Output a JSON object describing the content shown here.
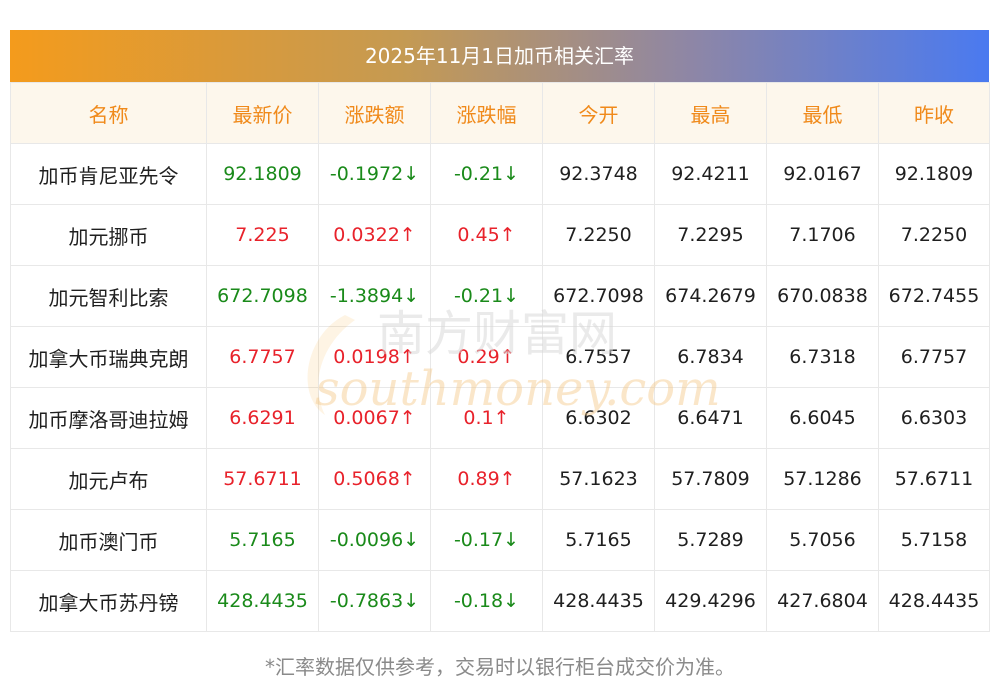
{
  "title": "2025年11月1日加币相关汇率",
  "columns": [
    "名称",
    "最新价",
    "涨跌额",
    "涨跌幅",
    "今开",
    "最高",
    "最低",
    "昨收"
  ],
  "rows": [
    {
      "name": "加币肯尼亚先令",
      "latest": "92.1809",
      "change": "-0.1972↓",
      "pct": "-0.21↓",
      "open": "92.3748",
      "high": "92.4211",
      "low": "92.0167",
      "prev": "92.1809",
      "dir": "down"
    },
    {
      "name": "加元挪币",
      "latest": "7.225",
      "change": "0.0322↑",
      "pct": "0.45↑",
      "open": "7.2250",
      "high": "7.2295",
      "low": "7.1706",
      "prev": "7.2250",
      "dir": "up"
    },
    {
      "name": "加元智利比索",
      "latest": "672.7098",
      "change": "-1.3894↓",
      "pct": "-0.21↓",
      "open": "672.7098",
      "high": "674.2679",
      "low": "670.0838",
      "prev": "672.7455",
      "dir": "down"
    },
    {
      "name": "加拿大币瑞典克朗",
      "latest": "6.7757",
      "change": "0.0198↑",
      "pct": "0.29↑",
      "open": "6.7557",
      "high": "6.7834",
      "low": "6.7318",
      "prev": "6.7757",
      "dir": "up"
    },
    {
      "name": "加币摩洛哥迪拉姆",
      "latest": "6.6291",
      "change": "0.0067↑",
      "pct": "0.1↑",
      "open": "6.6302",
      "high": "6.6471",
      "low": "6.6045",
      "prev": "6.6303",
      "dir": "up"
    },
    {
      "name": "加元卢布",
      "latest": "57.6711",
      "change": "0.5068↑",
      "pct": "0.89↑",
      "open": "57.1623",
      "high": "57.7809",
      "low": "57.1286",
      "prev": "57.6711",
      "dir": "up"
    },
    {
      "name": "加币澳门币",
      "latest": "5.7165",
      "change": "-0.0096↓",
      "pct": "-0.17↓",
      "open": "5.7165",
      "high": "5.7289",
      "low": "5.7056",
      "prev": "5.7158",
      "dir": "down"
    },
    {
      "name": "加拿大币苏丹镑",
      "latest": "428.4435",
      "change": "-0.7863↓",
      "pct": "-0.18↓",
      "open": "428.4435",
      "high": "429.4296",
      "low": "427.6804",
      "prev": "428.4435",
      "dir": "down"
    }
  ],
  "footnote": "*汇率数据仅供参考，交易时以银行柜台成交价为准。",
  "watermark": {
    "cn": "南方财富网",
    "en": "southmoney.com"
  },
  "colors": {
    "up": "#e8222b",
    "down": "#1a8a1a",
    "header_text": "#f08a1b",
    "header_bg": "#fdf7ec"
  }
}
